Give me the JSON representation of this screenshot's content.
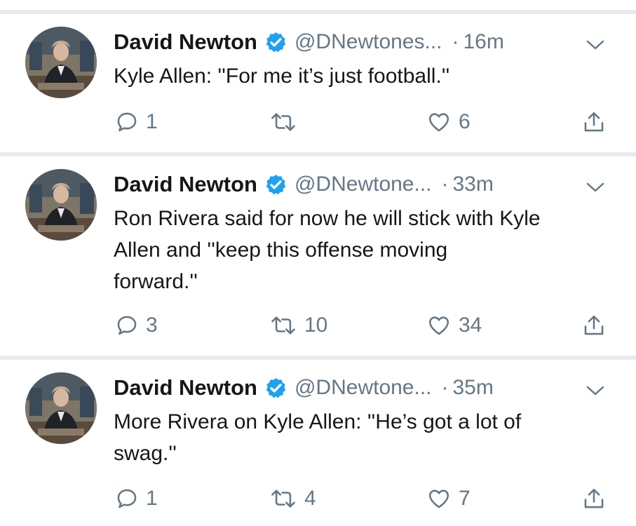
{
  "colors": {
    "text": "#14171a",
    "secondary": "#657786",
    "verified": "#1da1f2",
    "separator": "#e6ecf0"
  },
  "icons": {
    "verified": "verified-badge-icon",
    "caret": "chevron-down-icon",
    "reply": "reply-icon",
    "retweet": "retweet-icon",
    "like": "heart-icon",
    "share": "share-icon"
  },
  "tweets": [
    {
      "name": "David Newton",
      "handle": "@DNewtones...",
      "dot": "·",
      "time": "16m",
      "text_lines": [
        "Kyle Allen: ''For me it’s just football.''"
      ],
      "replies": "1",
      "retweets": "",
      "likes": "6"
    },
    {
      "name": "David Newton",
      "handle": "@DNewtone...",
      "dot": "·",
      "time": "33m",
      "text_lines": [
        "Ron Rivera said for now he will stick with Kyle",
        "Allen and ''keep this offense moving",
        "forward.''"
      ],
      "replies": "3",
      "retweets": "10",
      "likes": "34"
    },
    {
      "name": "David Newton",
      "handle": "@DNewtone...",
      "dot": "·",
      "time": "35m",
      "text_lines": [
        "More Rivera on Kyle Allen: ''He’s got a lot of",
        "swag.''"
      ],
      "replies": "1",
      "retweets": "4",
      "likes": "7"
    }
  ]
}
